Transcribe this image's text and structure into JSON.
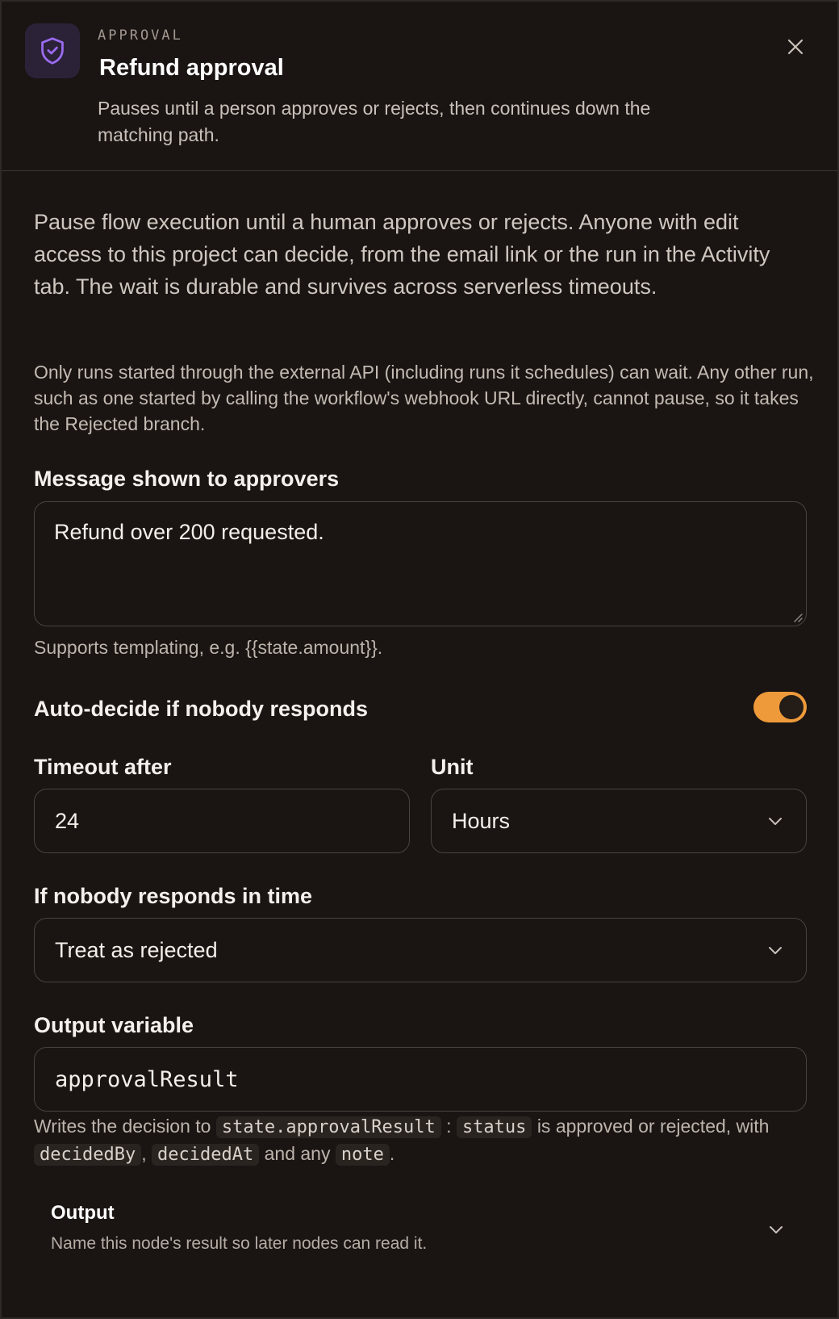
{
  "header": {
    "eyebrow": "APPROVAL",
    "title": "Refund approval",
    "subtitle": "Pauses until a person approves or rejects, then continues down the matching path.",
    "icon": "shield-check-icon",
    "accent_color": "#9b6cf0"
  },
  "intro": {
    "description": "Pause flow execution until a human approves or rejects. Anyone with edit access to this project can decide, from the email link or the run in the Activity tab. The wait is durable and survives across serverless timeouts.",
    "note": "Only runs started through the external API (including runs it schedules) can wait. Any other run, such as one started by calling the workflow's webhook URL directly, cannot pause, so it takes the Rejected branch."
  },
  "message": {
    "label": "Message shown to approvers",
    "value": "Refund over 200 requested.",
    "help": "Supports templating, e.g. {{state.amount}}."
  },
  "auto_decide": {
    "label": "Auto-decide if nobody responds",
    "enabled": true,
    "toggle_color": "#ee9a3a"
  },
  "timeout": {
    "label": "Timeout after",
    "value": "24"
  },
  "unit": {
    "label": "Unit",
    "selected": "Hours"
  },
  "fallback": {
    "label": "If nobody responds in time",
    "selected": "Treat as rejected"
  },
  "output_variable": {
    "label": "Output variable",
    "value": "approvalResult",
    "help": {
      "t1": "Writes the decision to",
      "c1": "state.approvalResult",
      "t2": ":",
      "c2": "status",
      "t3": "is approved or rejected, with",
      "c3": "decidedBy",
      "t4": ",",
      "c4": "decidedAt",
      "t5": "and any",
      "c5": "note",
      "t6": "."
    }
  },
  "output_section": {
    "title": "Output",
    "subtitle": "Name this node's result so later nodes can read it."
  }
}
